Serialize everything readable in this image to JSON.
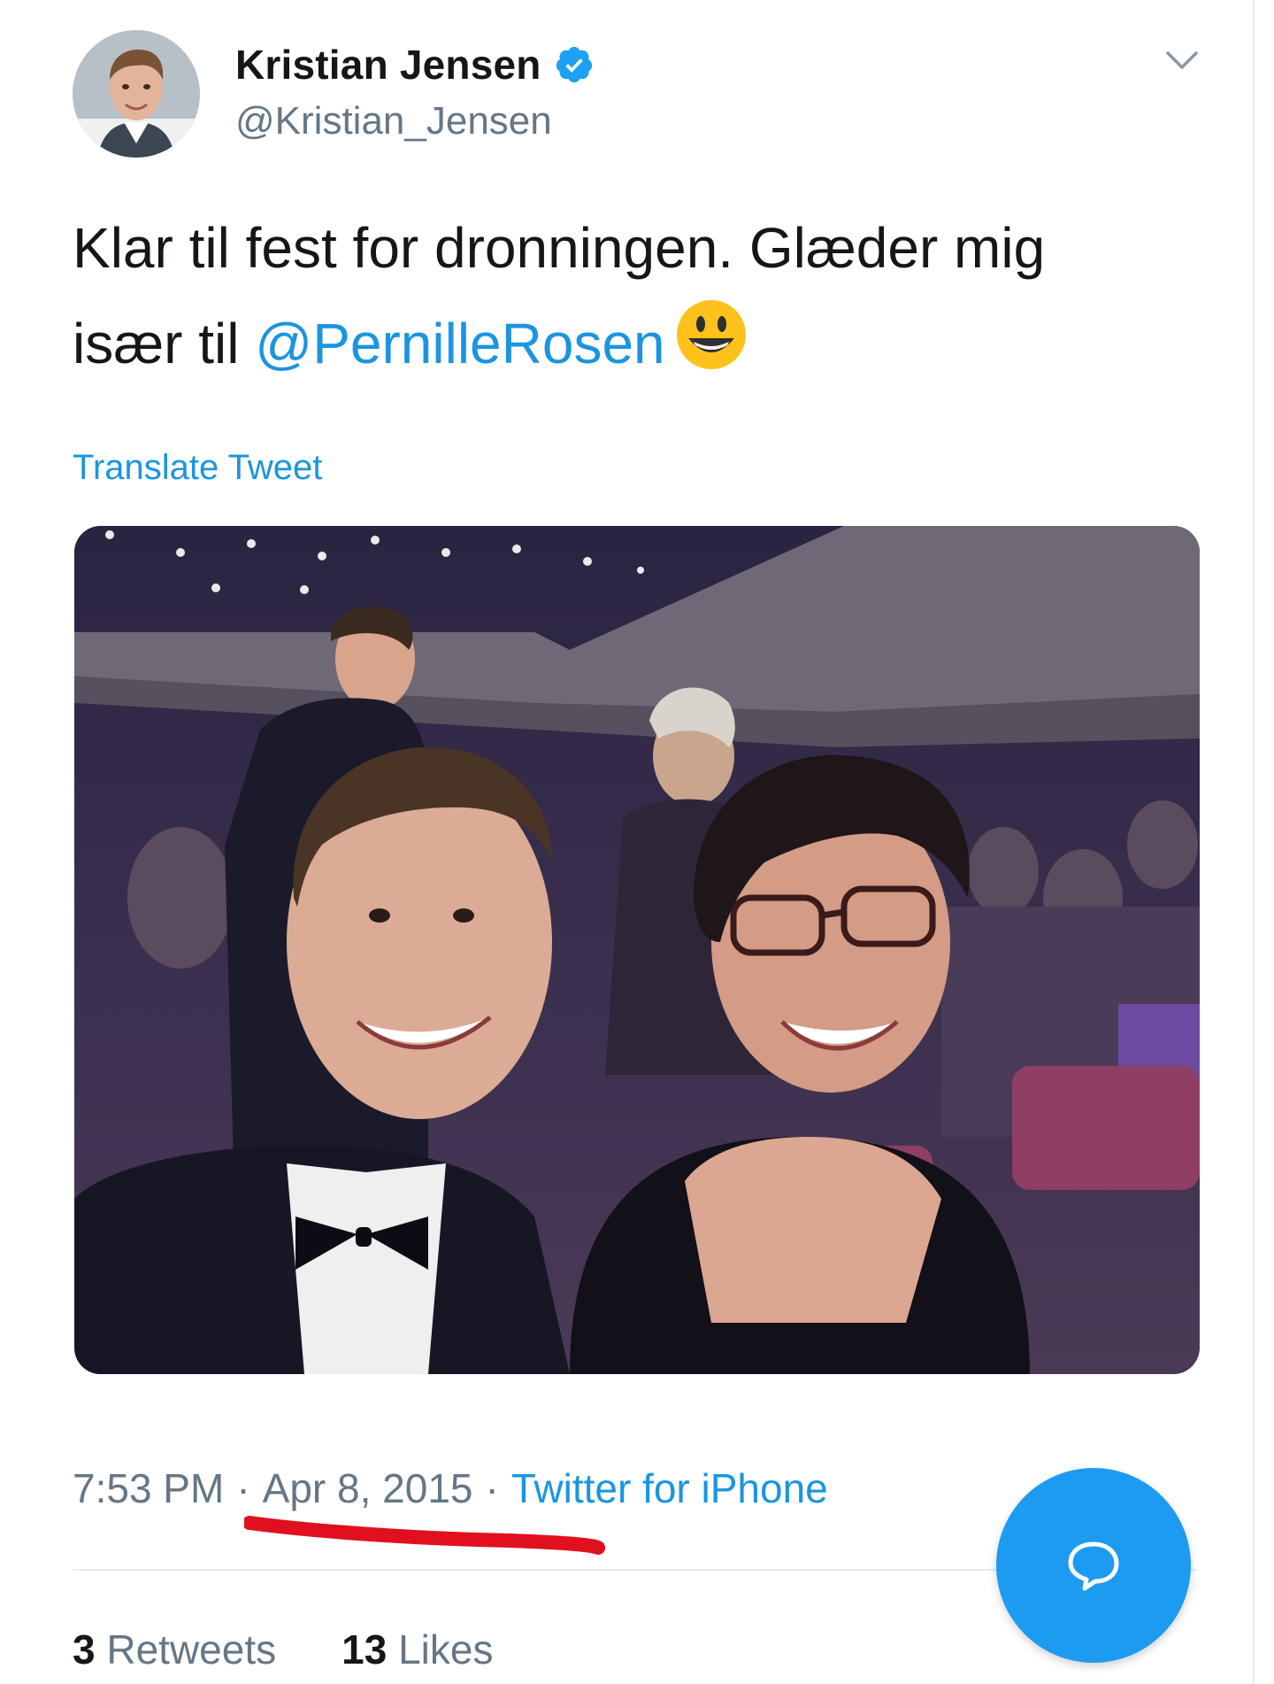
{
  "author": {
    "display_name": "Kristian Jensen",
    "handle": "@Kristian_Jensen",
    "verified": true
  },
  "tweet": {
    "text_before": "Klar til fest for dronningen. Glæder mig især til ",
    "mention": "@PernilleRosen",
    "emoji": "smiley-emoji",
    "translate_label": "Translate Tweet"
  },
  "meta": {
    "time": "7:53 PM",
    "separator": "·",
    "date": "Apr 8, 2015",
    "source": "Twitter for iPhone"
  },
  "stats": {
    "retweets_count": "3",
    "retweets_label": "Retweets",
    "likes_count": "13",
    "likes_label": "Likes"
  },
  "icons": {
    "verified": "verified-badge-icon",
    "menu": "chevron-down-icon",
    "compose": "reply-bubble-icon"
  },
  "colors": {
    "accent": "#1b95e0",
    "fab": "#1d9bf0",
    "annotation": "#e0101e",
    "muted": "#657786"
  }
}
